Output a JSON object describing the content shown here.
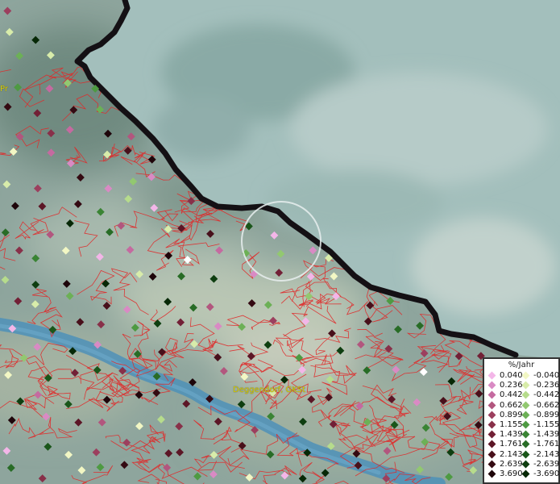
{
  "map": {
    "labels": {
      "deggendorf": "Deggendorf, GKSt",
      "partial": "Pr"
    },
    "colors": {
      "border": "#141014",
      "districts": "#e02a2a",
      "river": "#4e90b8",
      "highlight_ring": "#e8eeee"
    }
  },
  "legend": {
    "title": "%/Jahr",
    "positive": [
      {
        "value": "0.040",
        "color": "#f3b6e8"
      },
      {
        "value": "0.236",
        "color": "#d98ac4"
      },
      {
        "value": "0.442",
        "color": "#c56aa0"
      },
      {
        "value": "0.662",
        "color": "#b2567e"
      },
      {
        "value": "0.899",
        "color": "#9c3f5e"
      },
      {
        "value": "1.155",
        "color": "#883049"
      },
      {
        "value": "1.439",
        "color": "#722036"
      },
      {
        "value": "1.761",
        "color": "#5c1626"
      },
      {
        "value": "2.143",
        "color": "#48101b"
      },
      {
        "value": "2.639",
        "color": "#340a12"
      },
      {
        "value": "3.690",
        "color": "#1e050a"
      }
    ],
    "negative": [
      {
        "value": "-0.040",
        "color": "#f2f7c4"
      },
      {
        "value": "-0.236",
        "color": "#d8ecaa"
      },
      {
        "value": "-0.442",
        "color": "#b6dc8c"
      },
      {
        "value": "-0.662",
        "color": "#92c870"
      },
      {
        "value": "-0.899",
        "color": "#6cb056"
      },
      {
        "value": "-1.155",
        "color": "#4e9a42"
      },
      {
        "value": "-1.439",
        "color": "#3a8434"
      },
      {
        "value": "-1.761",
        "color": "#286c26"
      },
      {
        "value": "-2.143",
        "color": "#1a561a"
      },
      {
        "value": "-2.639",
        "color": "#0e3e10"
      },
      {
        "value": "-3.690",
        "color": "#062806"
      }
    ]
  }
}
